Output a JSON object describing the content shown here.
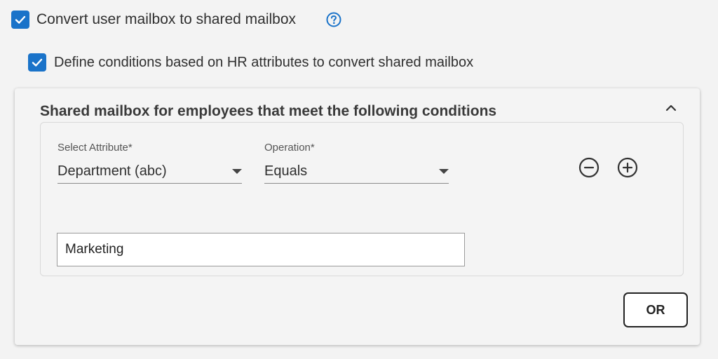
{
  "convert_checkbox": {
    "checked": true,
    "label": "Convert user mailbox to shared mailbox"
  },
  "hr_checkbox": {
    "checked": true,
    "label": "Define conditions based on HR attributes to convert shared mailbox"
  },
  "conditions_card": {
    "title": "Shared mailbox for employees that meet the following conditions",
    "attribute_label": "Select Attribute*",
    "attribute_value": "Department (abc)",
    "operation_label": "Operation*",
    "operation_value": "Equals",
    "value_input": "Marketing",
    "or_button": "OR"
  },
  "icons": {
    "help": "question-circle-icon",
    "collapse": "chevron-up-icon",
    "remove": "minus-circle-icon",
    "add": "plus-circle-icon"
  },
  "colors": {
    "accent": "#1a73c9",
    "background": "#f3f3f3"
  }
}
